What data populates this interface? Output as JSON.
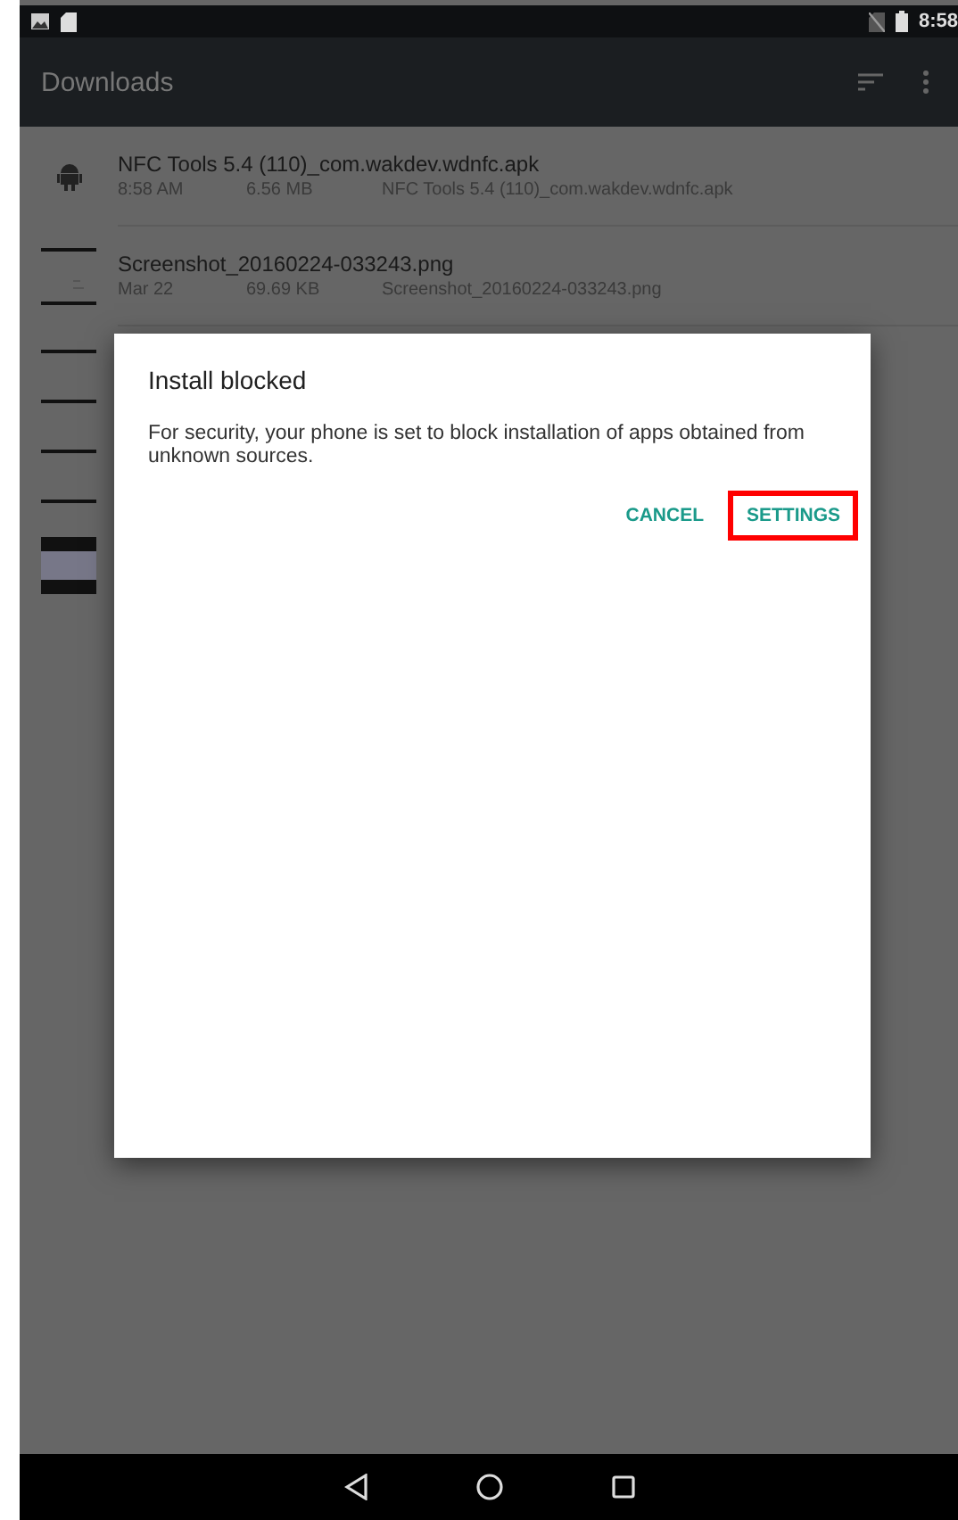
{
  "status_bar": {
    "time": "8:58"
  },
  "app_bar": {
    "title": "Downloads"
  },
  "files": [
    {
      "kind": "apk",
      "name": "NFC Tools 5.4 (110)_com.wakdev.wdnfc.apk",
      "date": "8:58 AM",
      "size": "6.56 MB",
      "description": "NFC Tools 5.4 (110)_com.wakdev.wdnfc.apk"
    },
    {
      "kind": "screenshot",
      "name": "Screenshot_20160224-033243.png",
      "date": "Mar 22",
      "size": "69.69 KB",
      "description": "Screenshot_20160224-033243.png"
    }
  ],
  "covered_rows": [
    {
      "kind": "line"
    },
    {
      "kind": "line"
    },
    {
      "kind": "line"
    },
    {
      "kind": "line"
    },
    {
      "kind": "image"
    }
  ],
  "dialog": {
    "title": "Install blocked",
    "message": "For security, your phone is set to block installation of apps obtained from unknown sources.",
    "buttons": [
      {
        "label": "CANCEL",
        "highlighted": false
      },
      {
        "label": "SETTINGS",
        "highlighted": true
      }
    ]
  }
}
